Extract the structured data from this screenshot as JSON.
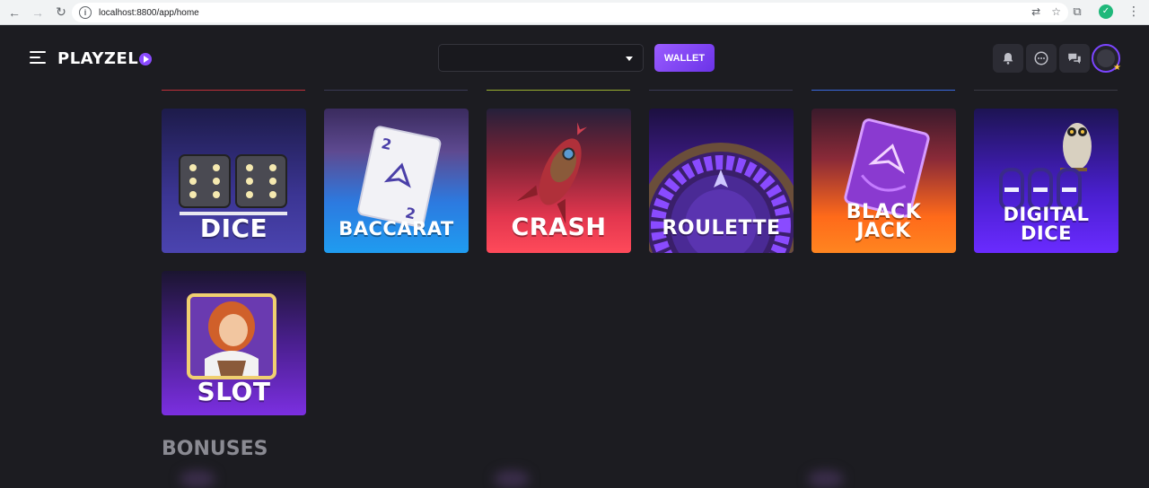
{
  "browser": {
    "url": "localhost:8800/app/home",
    "profile_initial": "✓"
  },
  "header": {
    "logo_text": "PLAYZEL",
    "wallet_label": "WALLET",
    "select_value": "",
    "icons": [
      "menu-icon",
      "bell-icon",
      "chat-icon",
      "messages-icon",
      "avatar"
    ]
  },
  "games": [
    {
      "label": "DICE"
    },
    {
      "label": "BACCARAT"
    },
    {
      "label": "CRASH"
    },
    {
      "label": "ROULETTE"
    },
    {
      "label_line1": "BLACK",
      "label_line2": "JACK"
    },
    {
      "label_line1": "DIGITAL",
      "label_line2": "DICE"
    },
    {
      "label": "SLOT"
    }
  ],
  "sections": {
    "bonuses_title": "BONUSES"
  },
  "colors": {
    "accent": "#7b45ff",
    "background": "#1c1c21"
  }
}
